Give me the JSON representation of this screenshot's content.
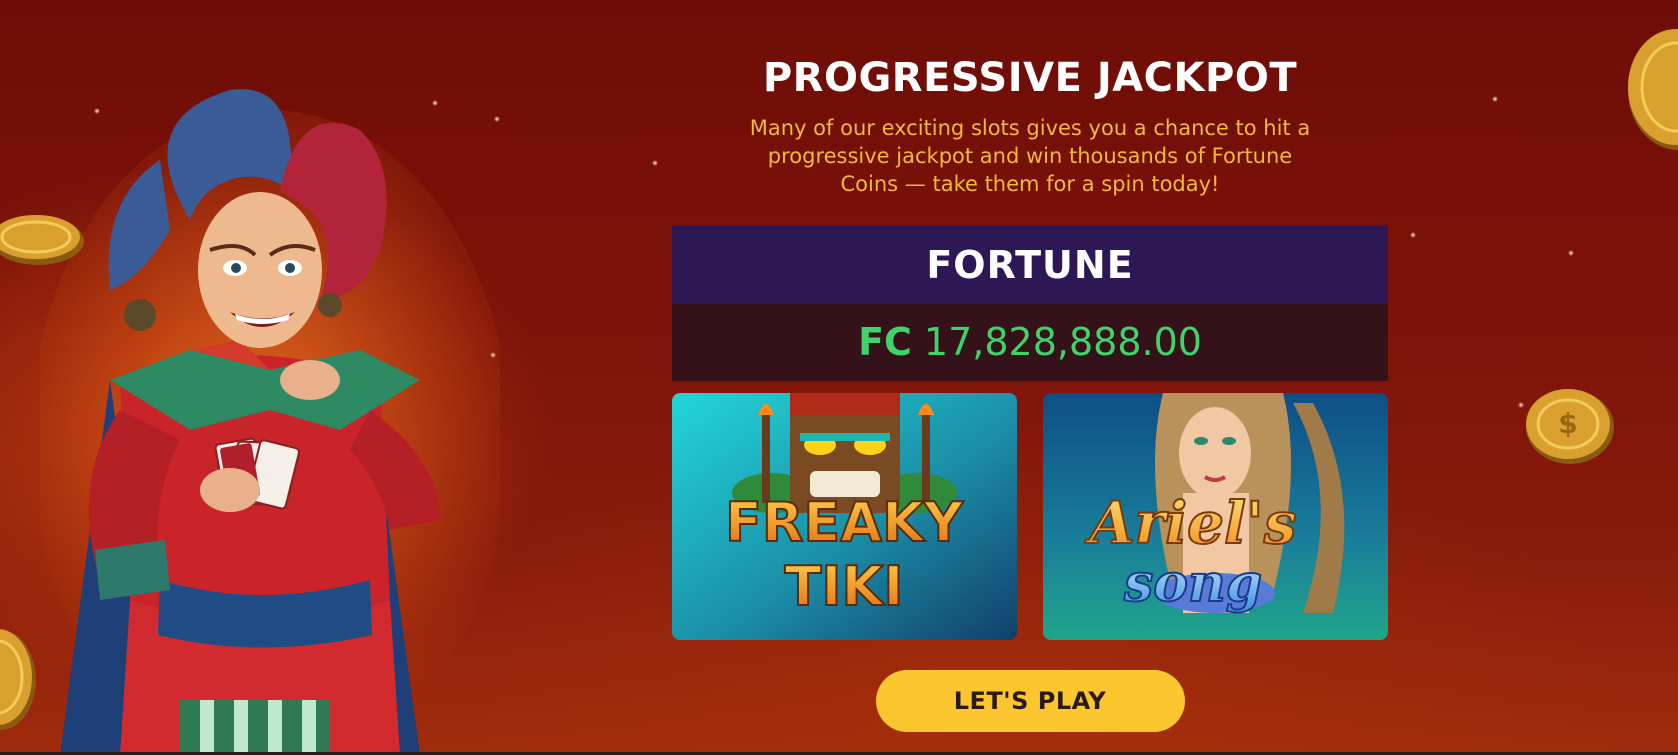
{
  "promo": {
    "title": "PROGRESSIVE JACKPOT",
    "description": "Many of our exciting slots gives you a chance to hit a progressive jackpot and win thousands of Fortune Coins — take them for a spin today!"
  },
  "jackpot": {
    "name": "FORTUNE",
    "currency": "FC",
    "amount": "17,828,888.00"
  },
  "games": [
    {
      "title_line1": "FREAKY",
      "title_line2": "TIKI"
    },
    {
      "title_line1": "Ariel's",
      "title_line2": "song"
    }
  ],
  "cta": {
    "label": "LET'S PLAY"
  },
  "colors": {
    "background": "#7d1209",
    "title": "#ffffff",
    "description": "#f2b93b",
    "jackpot_header": "#2e1755",
    "jackpot_body": "#35111a",
    "amount": "#3fd36a",
    "button": "#fcc62f"
  },
  "icons": [
    "joker-illustration",
    "gold-coin-icon",
    "tiki-mask-art",
    "mermaid-art"
  ]
}
